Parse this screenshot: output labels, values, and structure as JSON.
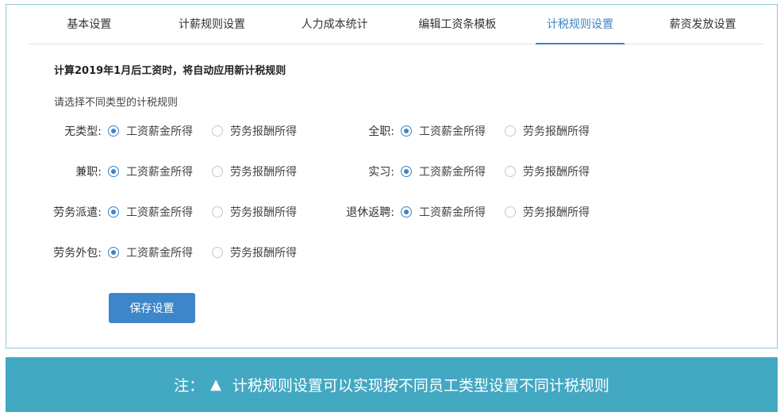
{
  "tabs": [
    {
      "label": "基本设置"
    },
    {
      "label": "计薪规则设置"
    },
    {
      "label": "人力成本统计"
    },
    {
      "label": "编辑工资条模板"
    },
    {
      "label": "计税规则设置"
    },
    {
      "label": "薪资发放设置"
    }
  ],
  "active_tab": "计税规则设置",
  "headline": "计算2019年1月后工资时，将自动应用新计税规则",
  "subhead": "请选择不同类型的计税规则",
  "option_a": "工资薪金所得",
  "option_b": "劳务报酬所得",
  "rules": [
    {
      "label": "无类型:",
      "selected": "工资薪金所得"
    },
    {
      "label": "全职:",
      "selected": "工资薪金所得"
    },
    {
      "label": "兼职:",
      "selected": "工资薪金所得"
    },
    {
      "label": "实习:",
      "selected": "工资薪金所得"
    },
    {
      "label": "劳务派遣:",
      "selected": "工资薪金所得"
    },
    {
      "label": "退休返聘:",
      "selected": "工资薪金所得"
    },
    {
      "label": "劳务外包:",
      "selected": "工资薪金所得"
    }
  ],
  "save_label": "保存设置",
  "note": {
    "prefix": "注：",
    "icon": "triangle-up-icon",
    "text": "计税规则设置可以实现按不同员工类型设置不同计税规则"
  },
  "colors": {
    "accent": "#3d83c6",
    "note_bg": "#43a8c2",
    "panel_border": "#8ec9d8"
  }
}
